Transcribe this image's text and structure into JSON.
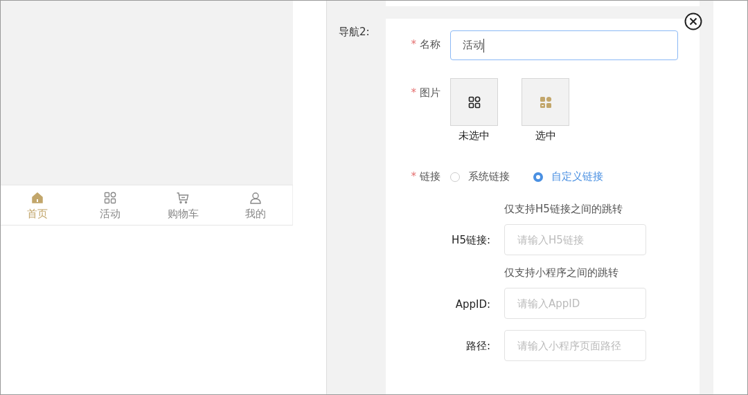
{
  "tab_bar": {
    "items": [
      {
        "label": "首页",
        "selected": true
      },
      {
        "label": "活动",
        "selected": false
      },
      {
        "label": "购物车",
        "selected": false
      },
      {
        "label": "我的",
        "selected": false
      }
    ]
  },
  "nav_label": "导航2:",
  "form": {
    "name": {
      "required_mark": "*",
      "label": "名称",
      "value": "活动",
      "focused": true
    },
    "image": {
      "required_mark": "*",
      "label": "图片",
      "slots": [
        {
          "caption": "未选中",
          "selected": false
        },
        {
          "caption": "选中",
          "selected": true
        }
      ]
    },
    "link": {
      "required_mark": "*",
      "label": "链接",
      "options": [
        {
          "label": "系统链接",
          "selected": false
        },
        {
          "label": "自定义链接",
          "selected": true
        }
      ]
    },
    "sub_fields": [
      {
        "label": "H5链接:",
        "hint": "仅支持H5链接之间的跳转",
        "placeholder": "请输入H5链接"
      },
      {
        "label": "AppID:",
        "hint": "仅支持小程序之间的跳转",
        "placeholder": "请输入AppID"
      },
      {
        "label": "路径:",
        "placeholder": "请输入小程序页面路径"
      }
    ]
  }
}
